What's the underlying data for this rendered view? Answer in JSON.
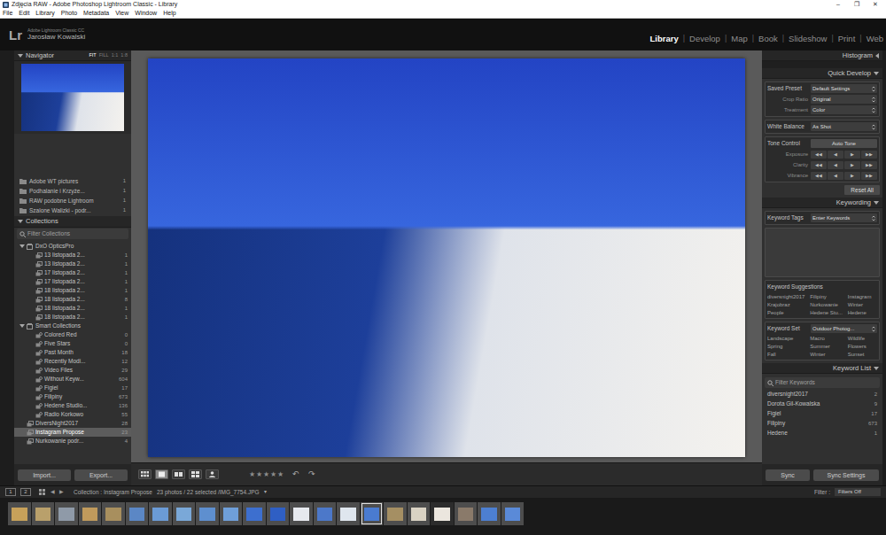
{
  "window": {
    "title": "Zdjęcia RAW - Adobe Photoshop Lightroom Classic - Library",
    "controls": [
      "–",
      "❐",
      "✕"
    ]
  },
  "menu": [
    "File",
    "Edit",
    "Library",
    "Photo",
    "Metadata",
    "View",
    "Window",
    "Help"
  ],
  "identity": {
    "logo": "Lr",
    "product": "Adobe Lightroom Classic CC",
    "user": "Jarosław Kowalski"
  },
  "modules": {
    "separator": "|",
    "items": [
      {
        "label": "Library",
        "selected": true
      },
      {
        "label": "Develop",
        "selected": false
      },
      {
        "label": "Map",
        "selected": false
      },
      {
        "label": "Book",
        "selected": false
      },
      {
        "label": "Slideshow",
        "selected": false
      },
      {
        "label": "Print",
        "selected": false
      },
      {
        "label": "Web",
        "selected": false
      }
    ]
  },
  "navigator": {
    "title": "Navigator",
    "expanded": true,
    "zooms": [
      {
        "label": "FIT",
        "selected": true
      },
      {
        "label": "FILL",
        "selected": false
      },
      {
        "label": "1:1",
        "selected": false
      },
      {
        "label": "1:8",
        "selected": false
      }
    ]
  },
  "folders": [
    {
      "name": "Adobe WT pictures",
      "count": "1"
    },
    {
      "name": "Podhalanie i Krzyże...",
      "count": "1"
    },
    {
      "name": "RAW podobne Lightroom",
      "count": "1"
    },
    {
      "name": "Szalone Walizki - podr...",
      "count": "1"
    }
  ],
  "collections": {
    "title": "Collections",
    "expanded": true,
    "filter_placeholder": "Filter Collections",
    "items": [
      {
        "name": "DxO OpticsPro",
        "depth": 0,
        "kind": "set",
        "expanded": true,
        "selected": false
      },
      {
        "name": "13 listopada 2...",
        "count": "1",
        "depth": 1,
        "kind": "collection",
        "selected": false
      },
      {
        "name": "13 listopada 2...",
        "count": "1",
        "depth": 1,
        "kind": "collection",
        "selected": false
      },
      {
        "name": "17 listopada 2...",
        "count": "1",
        "depth": 1,
        "kind": "collection",
        "selected": false
      },
      {
        "name": "17 listopada 2...",
        "count": "1",
        "depth": 1,
        "kind": "collection",
        "selected": false
      },
      {
        "name": "18 listopada 2...",
        "count": "1",
        "depth": 1,
        "kind": "collection",
        "selected": false
      },
      {
        "name": "18 listopada 2...",
        "count": "8",
        "depth": 1,
        "kind": "collection",
        "selected": false
      },
      {
        "name": "18 listopada 2...",
        "count": "1",
        "depth": 1,
        "kind": "collection",
        "selected": false
      },
      {
        "name": "18 listopada 2...",
        "count": "1",
        "depth": 1,
        "kind": "collection",
        "selected": false
      },
      {
        "name": "Smart Collections",
        "depth": 0,
        "kind": "set",
        "expanded": true,
        "selected": false
      },
      {
        "name": "Colored Red",
        "count": "0",
        "depth": 1,
        "kind": "smart",
        "selected": false
      },
      {
        "name": "Five Stars",
        "count": "0",
        "depth": 1,
        "kind": "smart",
        "selected": false
      },
      {
        "name": "Past Month",
        "count": "18",
        "depth": 1,
        "kind": "smart",
        "selected": false
      },
      {
        "name": "Recently Modi...",
        "count": "12",
        "depth": 1,
        "kind": "smart",
        "selected": false
      },
      {
        "name": "Video Files",
        "count": "29",
        "depth": 1,
        "kind": "smart",
        "selected": false
      },
      {
        "name": "Without Keyw...",
        "count": "604",
        "depth": 1,
        "kind": "smart",
        "selected": false
      },
      {
        "name": "Figiel",
        "count": "17",
        "depth": 1,
        "kind": "smart",
        "selected": false
      },
      {
        "name": "Filipiny",
        "count": "673",
        "depth": 1,
        "kind": "smart",
        "selected": false
      },
      {
        "name": "Hedene Studio...",
        "count": "136",
        "depth": 1,
        "kind": "smart",
        "selected": false
      },
      {
        "name": "Radio Korkowo",
        "count": "55",
        "depth": 1,
        "kind": "smart",
        "selected": false
      },
      {
        "name": "DiversNight2017",
        "count": "28",
        "depth": 0,
        "kind": "collection",
        "selected": false
      },
      {
        "name": "Instagram Propose",
        "count": "23",
        "depth": 0,
        "kind": "collection",
        "selected": true
      },
      {
        "name": "Nurkowanie podr...",
        "count": "4",
        "depth": 0,
        "kind": "collection",
        "selected": false
      }
    ]
  },
  "left_buttons": [
    "Import...",
    "Export..."
  ],
  "toolbar": {
    "views": [
      {
        "kind": "grid",
        "selected": false
      },
      {
        "kind": "loupe",
        "selected": true
      },
      {
        "kind": "compare",
        "selected": false
      },
      {
        "kind": "survey",
        "selected": false
      },
      {
        "kind": "people",
        "selected": false
      }
    ],
    "rating": {
      "glyph": "★",
      "stars": 0,
      "max": 5
    },
    "rotate": [
      "↶",
      "↷"
    ]
  },
  "histogram": {
    "title": "Histogram",
    "expanded": false
  },
  "quick_develop": {
    "title": "Quick Develop",
    "expanded": true,
    "groups": [
      {
        "label": "Saved Preset",
        "value": "Default Settings",
        "kind": "select",
        "rows": [
          {
            "label": "Crop Ratio",
            "value": "Original",
            "kind": "select"
          },
          {
            "label": "Treatment",
            "value": "Color",
            "kind": "select"
          }
        ]
      },
      {
        "label": "White Balance",
        "value": "As Shot",
        "kind": "select",
        "rows": []
      },
      {
        "label": "Tone Control",
        "value": "Auto Tone",
        "kind": "button",
        "rows": [
          {
            "label": "Exposure",
            "kind": "steppers"
          },
          {
            "label": "Clarity",
            "kind": "steppers"
          },
          {
            "label": "Vibrance",
            "kind": "steppers"
          }
        ]
      }
    ],
    "steppers": [
      "◀◀",
      "◀",
      "▶",
      "▶▶"
    ],
    "reset": "Reset All"
  },
  "keywording": {
    "title": "Keywording",
    "expanded": true,
    "tags_label": "Keyword Tags",
    "tags_value": "Enter Keywords",
    "suggestions_label": "Keyword Suggestions",
    "suggestions": [
      "diversnight2017",
      "Filipiny",
      "Instagram",
      "Krajobraz",
      "Nurkowanie",
      "Winter",
      "People",
      "Hedene Stu...",
      "Hedene"
    ],
    "set_label": "Keyword Set",
    "set_value": "Outdoor Photog...",
    "set_items": [
      "Landscape",
      "Macro",
      "Wildlife",
      "Spring",
      "Summer",
      "Flowers",
      "Fall",
      "Winter",
      "Sunset"
    ]
  },
  "keyword_list": {
    "title": "Keyword List",
    "expanded": true,
    "filter_placeholder": "Filter Keywords",
    "items": [
      {
        "name": "diversnight2017",
        "count": "2"
      },
      {
        "name": "Dorota Gil-Kowalska",
        "count": "9"
      },
      {
        "name": "Figiel",
        "count": "17"
      },
      {
        "name": "Filipiny",
        "count": "673"
      },
      {
        "name": "Hedene",
        "count": "1"
      }
    ]
  },
  "sync_buttons": [
    "Sync",
    "Sync Settings"
  ],
  "filmstrip_bar": {
    "screens": [
      "1",
      "2"
    ],
    "nav": [
      "◀",
      "▶"
    ],
    "source": "Collection : Instagram Propose",
    "info": "23 photos / 22 selected /IMG_7754.JPG",
    "dropdown": "▾",
    "filter_label": "Filter :",
    "filter_value": "Filters Off"
  },
  "filmstrip": [
    {
      "color": "#c7a15a",
      "selected": true,
      "active": false
    },
    {
      "color": "#b9a06b",
      "selected": true,
      "active": false
    },
    {
      "color": "#8f9aa8",
      "selected": true,
      "active": false
    },
    {
      "color": "#c09a5c",
      "selected": true,
      "active": false
    },
    {
      "color": "#a88f5e",
      "selected": true,
      "active": false
    },
    {
      "color": "#5b87c5",
      "selected": true,
      "active": false
    },
    {
      "color": "#6b9bd6",
      "selected": true,
      "active": false
    },
    {
      "color": "#7aa8d8",
      "selected": true,
      "active": false
    },
    {
      "color": "#5e8fcf",
      "selected": true,
      "active": false
    },
    {
      "color": "#6f9fd9",
      "selected": true,
      "active": false
    },
    {
      "color": "#3d6fcf",
      "selected": true,
      "active": false
    },
    {
      "color": "#2f5fc4",
      "selected": true,
      "active": false
    },
    {
      "color": "#e6e9ee",
      "selected": true,
      "active": false
    },
    {
      "color": "#4c78c9",
      "selected": true,
      "active": false
    },
    {
      "color": "#dfe6ee",
      "selected": true,
      "active": false
    },
    {
      "color": "#4a7bd0",
      "selected": true,
      "active": true
    },
    {
      "color": "#a58f63",
      "selected": true,
      "active": false
    },
    {
      "color": "#d9d2c3",
      "selected": true,
      "active": false
    },
    {
      "color": "#ebe6de",
      "selected": false,
      "active": false
    },
    {
      "color": "#8a7a6a",
      "selected": true,
      "active": false
    },
    {
      "color": "#4d7fd1",
      "selected": true,
      "active": false
    },
    {
      "color": "#5a8ad8",
      "selected": true,
      "active": false
    }
  ]
}
